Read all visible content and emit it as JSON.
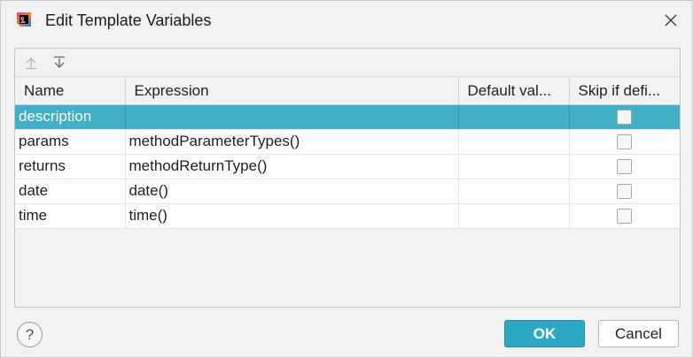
{
  "window": {
    "title": "Edit Template Variables",
    "icon": "intellij-idea-icon"
  },
  "toolbar": {
    "move_up_icon": "arrow-up-icon",
    "move_down_icon": "arrow-down-icon"
  },
  "table": {
    "columns": [
      "Name",
      "Expression",
      "Default val...",
      "Skip if defi..."
    ],
    "rows": [
      {
        "name": "description",
        "expression": "",
        "default": "",
        "skip": false,
        "selected": true
      },
      {
        "name": "params",
        "expression": "methodParameterTypes()",
        "default": "",
        "skip": false,
        "selected": false
      },
      {
        "name": "returns",
        "expression": "methodReturnType()",
        "default": "",
        "skip": false,
        "selected": false
      },
      {
        "name": "date",
        "expression": "date()",
        "default": "",
        "skip": false,
        "selected": false
      },
      {
        "name": "time",
        "expression": "time()",
        "default": "",
        "skip": false,
        "selected": false
      }
    ]
  },
  "footer": {
    "help_label": "?",
    "ok_label": "OK",
    "cancel_label": "Cancel"
  },
  "colors": {
    "selection": "#3fb0c6",
    "ok_button": "#2ea9c4"
  }
}
